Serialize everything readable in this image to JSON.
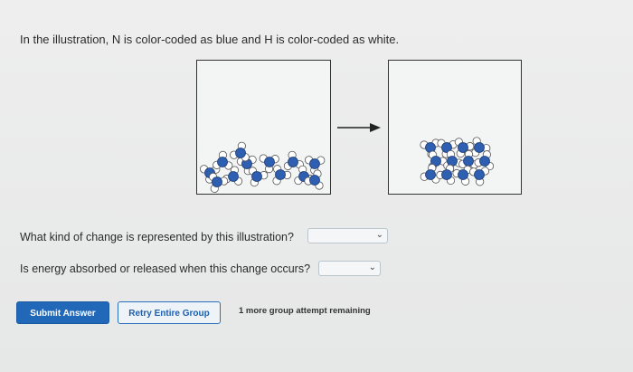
{
  "instructions": "In the illustration, N is color-coded as blue and H is color-coded as white.",
  "colors": {
    "nitrogen": "#2f5fb0",
    "hydrogen": "#ffffff",
    "primary_button": "#2168b9"
  },
  "illustration": {
    "arrow_icon": "right-arrow"
  },
  "questions": [
    {
      "text": "What kind of change is represented by this illustration?",
      "selected": ""
    },
    {
      "text": "Is energy absorbed or released when this change occurs?",
      "selected": ""
    }
  ],
  "buttons": {
    "submit": "Submit Answer",
    "retry": "Retry Entire Group"
  },
  "attempts_text": "1 more group attempt remaining"
}
